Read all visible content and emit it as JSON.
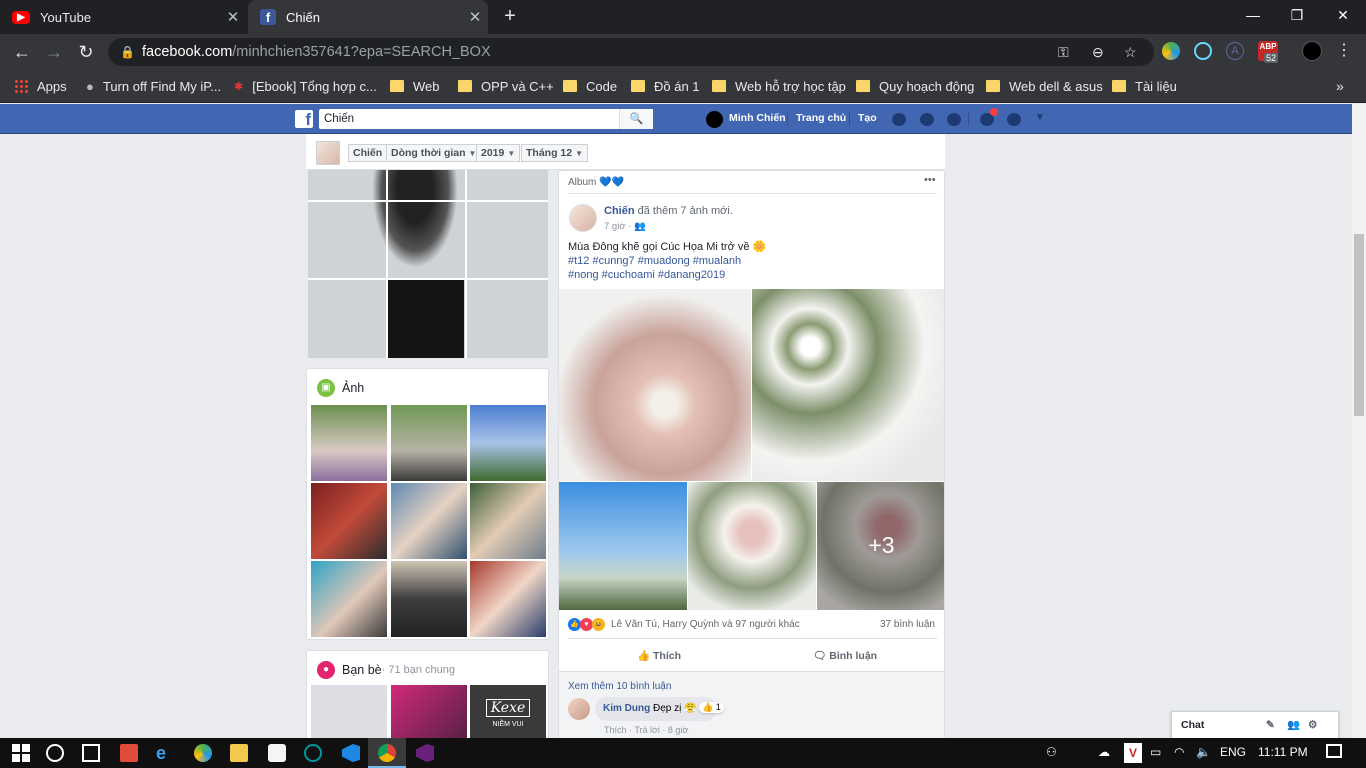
{
  "browser": {
    "tabs": [
      {
        "title": "YouTube",
        "icon": "youtube-icon"
      },
      {
        "title": "Chiến",
        "icon": "facebook-icon"
      }
    ],
    "address": {
      "host": "facebook.com",
      "path": "/minhchien357641?epa=SEARCH_BOX"
    },
    "ext_badge": "52",
    "bookmarks": [
      "Apps",
      "Turn off Find My iP...",
      "[Ebook] Tổng hợp c...",
      "Web",
      "OPP và C++",
      "Code",
      "Đồ án 1",
      "Web hỗ trợ học tập",
      "Quy hoạch động",
      "Web dell & asus",
      "Tài liệu"
    ]
  },
  "fb": {
    "search_value": "Chiến",
    "user_name": "Minh Chiến",
    "home": "Trang chủ",
    "create": "Tạo",
    "crumbs": [
      "Chiến",
      "Dòng thời gian",
      "2019",
      "Tháng 12"
    ]
  },
  "photos": {
    "title": "Ảnh"
  },
  "friends": {
    "title": "Bạn bè",
    "mutual": " · 71 bạn chung",
    "tile_text": "Kexe",
    "tile_sub": "NIỀM VUI"
  },
  "post": {
    "album_label": "Album 💙💙",
    "more": "•••",
    "author": "Chiến",
    "action": " đã thêm 7 ảnh mới.",
    "time": "7 giờ",
    "text": "Mùa Đông khẽ gọi Cúc Họa Mi trở về 🌼",
    "tags_line1": "#t12 #cunng7 #muadong #mualanh",
    "tags_line2": "#nong #cuchoami #danang2019",
    "more_photos": "+3",
    "reactions": "Lê Văn Tú, Harry Quỳnh và 97 người khác",
    "comments_count": "37 bình luận",
    "like": "Thích",
    "comment": "Bình luận",
    "view_more": "Xem thêm 10 bình luận",
    "comment_author": "Kim Dung",
    "comment_text": " Đẹp zị 😤",
    "comment_likes": "1",
    "comment_actions": "Thích · Trả lời · 8 giờ"
  },
  "chat": {
    "label": "Chat"
  },
  "taskbar": {
    "lang": "ENG",
    "time": "11:11 PM"
  },
  "colors": {
    "fb_blue": "#4267b2",
    "link": "#365899",
    "chrome_dark": "#202124"
  }
}
